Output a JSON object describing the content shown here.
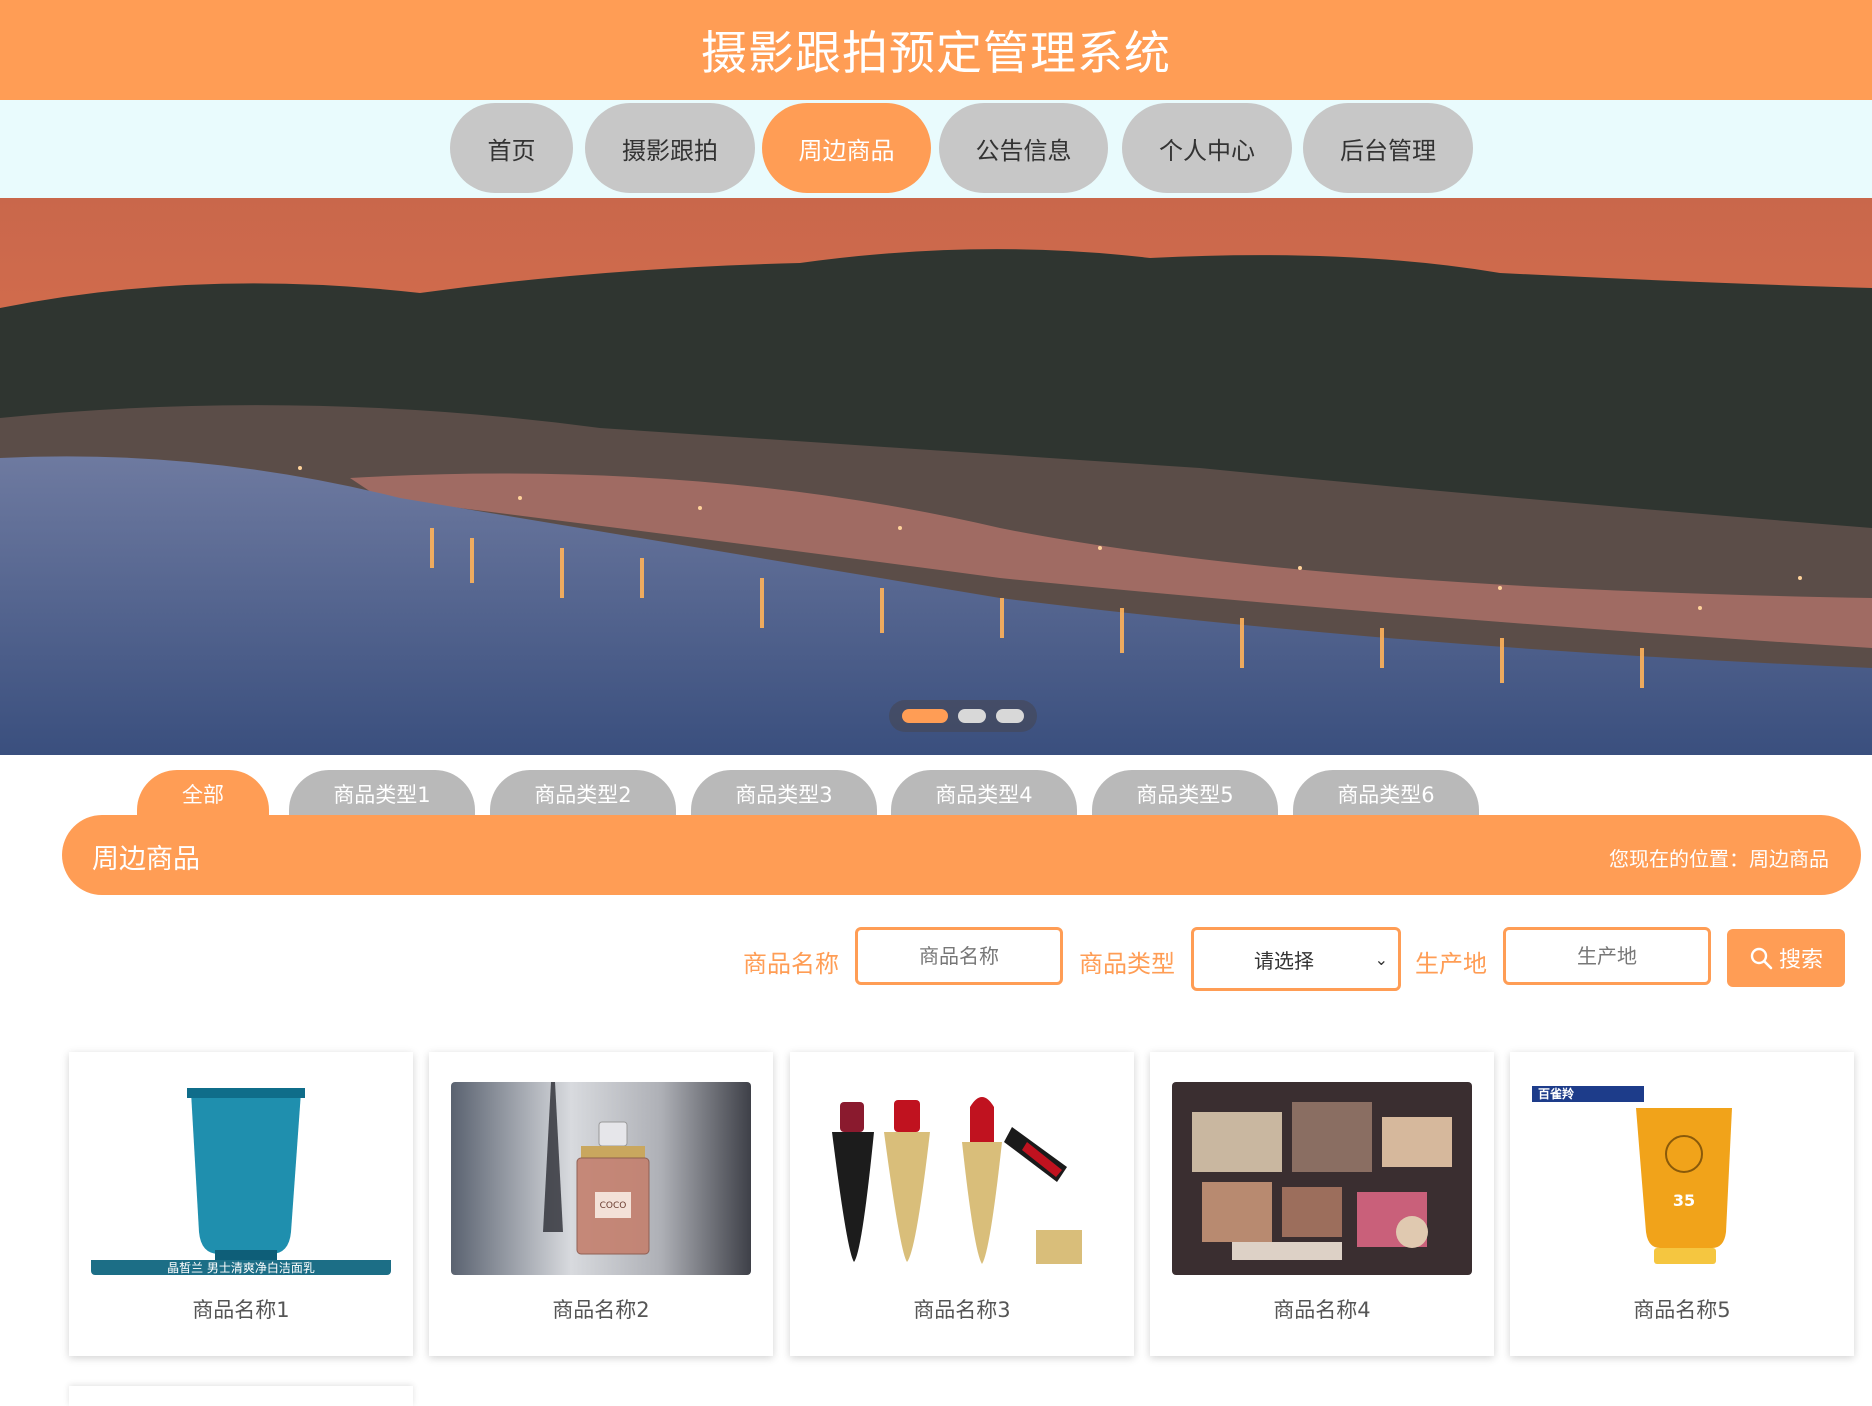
{
  "header": {
    "title": "摄影跟拍预定管理系统"
  },
  "nav": {
    "items": [
      {
        "label": "首页"
      },
      {
        "label": "摄影跟拍"
      },
      {
        "label": "周边商品",
        "active": true
      },
      {
        "label": "公告信息"
      },
      {
        "label": "个人中心"
      },
      {
        "label": "后台管理"
      }
    ]
  },
  "banner": {
    "slide_count": 3,
    "active_slide": 1
  },
  "categories": {
    "items": [
      "全部",
      "商品类型1",
      "商品类型2",
      "商品类型3",
      "商品类型4",
      "商品类型5",
      "商品类型6"
    ],
    "active": "全部"
  },
  "section": {
    "title": "周边商品",
    "breadcrumb": "您现在的位置：周边商品"
  },
  "search": {
    "name_label": "商品名称",
    "name_placeholder": "商品名称",
    "type_label": "商品类型",
    "type_selected": "请选择",
    "origin_label": "生产地",
    "origin_placeholder": "生产地",
    "button_label": "搜索"
  },
  "products": [
    {
      "name": "商品名称1",
      "image": "face-cleanser-tube",
      "image_text": "晶皙兰 男士清爽净白洁面乳"
    },
    {
      "name": "商品名称2",
      "image": "perfume-bottle",
      "image_text": "COCO"
    },
    {
      "name": "商品名称3",
      "image": "lipsticks"
    },
    {
      "name": "商品名称4",
      "image": "makeup-palettes"
    },
    {
      "name": "商品名称5",
      "image": "sunscreen-tube",
      "image_text": "百雀羚"
    }
  ],
  "colors": {
    "accent": "#ff9d55",
    "nav_bg": "#e9fbfd",
    "tab_inactive": "#b9b9b9",
    "nav_inactive": "#c7c7c7"
  }
}
